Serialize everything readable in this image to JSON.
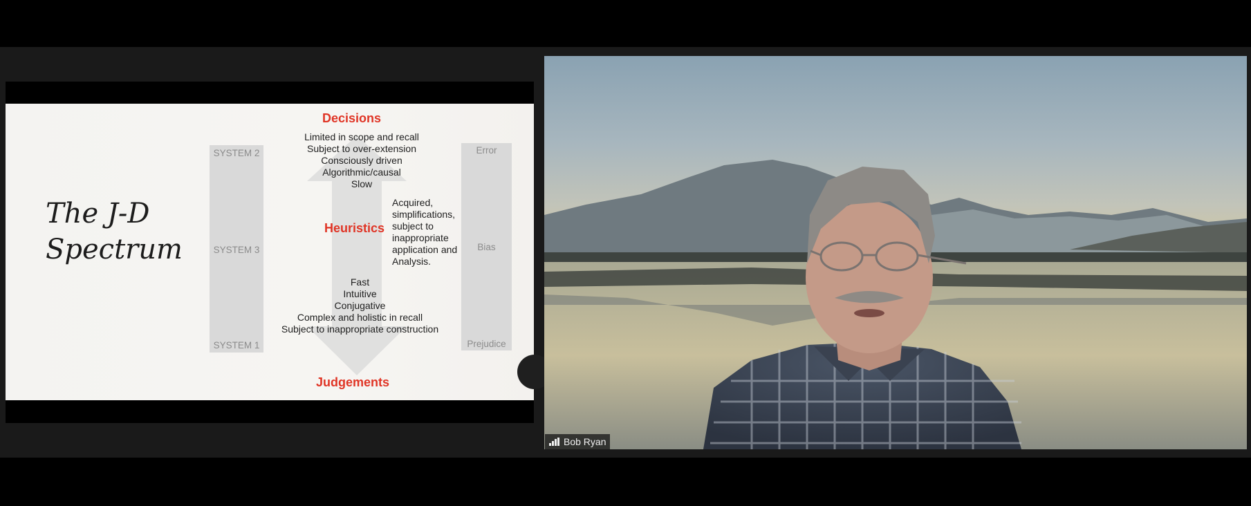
{
  "slide": {
    "title_line1": "The J-D",
    "title_line2": "Spectrum",
    "decisions": "Decisions",
    "heuristics": "Heuristics",
    "judgements": "Judgements",
    "system_labels": [
      "SYSTEM 2",
      "SYSTEM 3",
      "SYSTEM 1"
    ],
    "outcome_labels": [
      "Error",
      "Bias",
      "Prejudice"
    ],
    "top_lines": [
      "Limited in scope and recall",
      "Subject to over-extension",
      "Consciously driven",
      "Algorithmic/causal",
      "Slow"
    ],
    "middle_lines": [
      "Acquired,",
      "simplifications,",
      "subject to",
      "inappropriate",
      "application and",
      "Analysis."
    ],
    "bottom_lines": [
      "Fast",
      "Intuitive",
      "Conjugative",
      "Complex and holistic in recall",
      "Subject to inappropriate construction"
    ]
  },
  "participant": {
    "name": "Bob Ryan",
    "signal_icon": "signal-bars-icon"
  },
  "colors": {
    "accent_red": "#e03425",
    "column_gray": "#d9d9d9"
  }
}
